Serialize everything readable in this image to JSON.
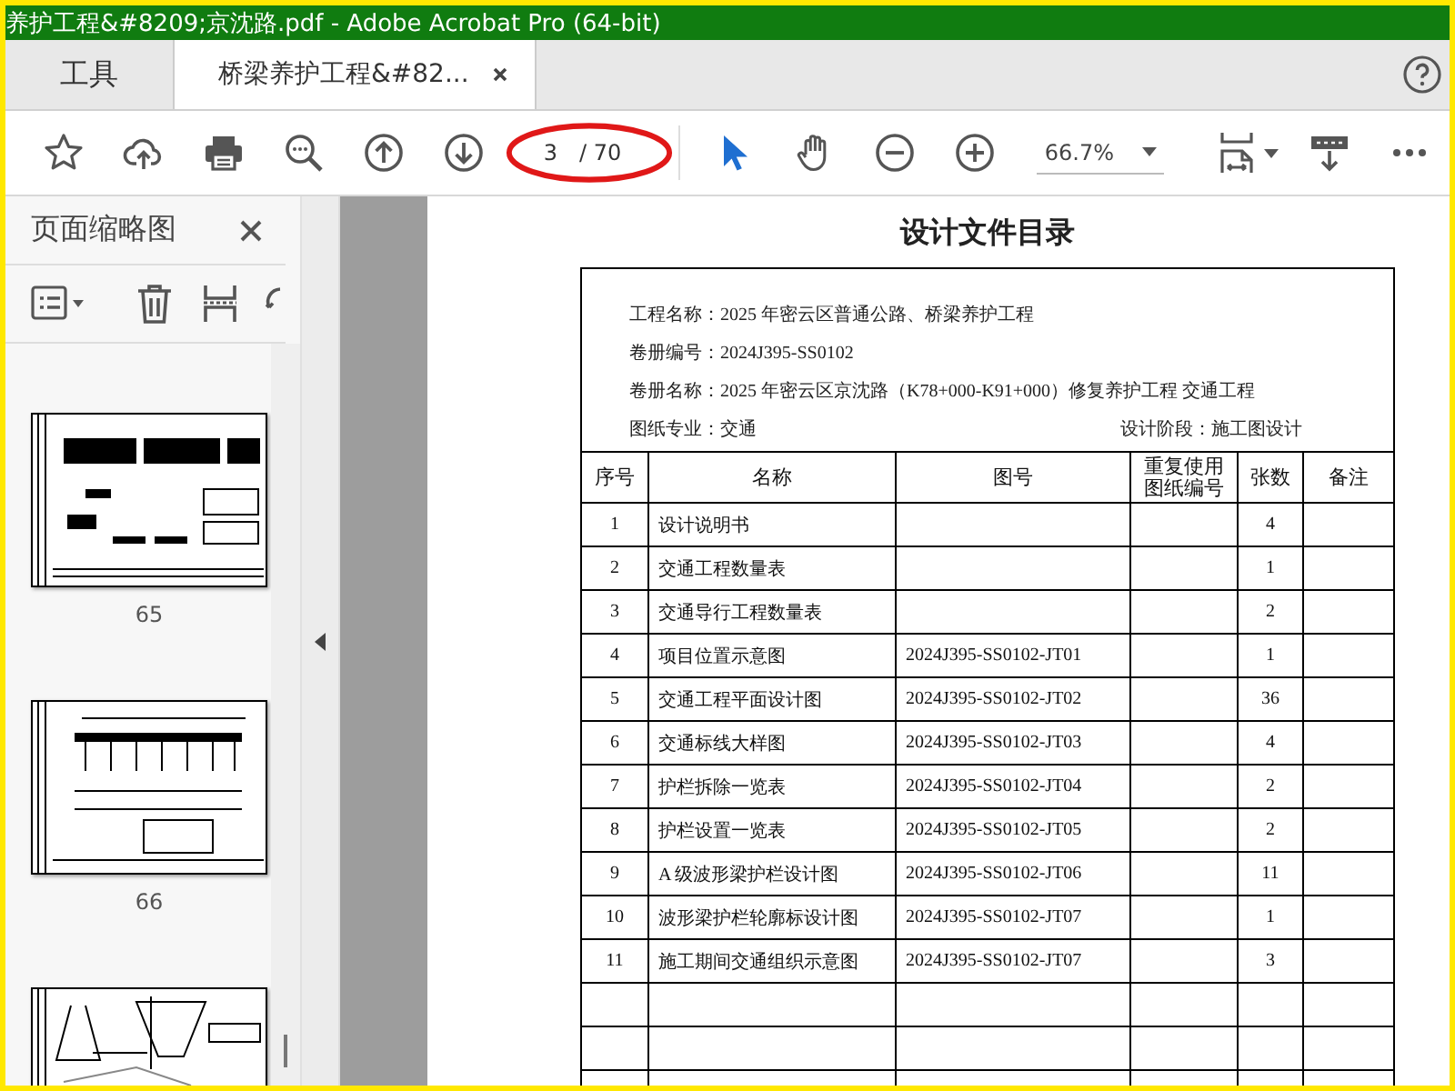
{
  "window": {
    "title": "养护工程&#8209;京沈路.pdf - Adobe Acrobat Pro (64-bit)"
  },
  "tabs": [
    {
      "label": "工具",
      "selected": false,
      "closable": false
    },
    {
      "label": "桥梁养护工程&#82...",
      "selected": true,
      "closable": true
    }
  ],
  "toolbar": {
    "page_current": "3",
    "page_total": "/ 70",
    "zoom": "66.7%",
    "pointer_tools": [
      {
        "kind": "select",
        "selected": true
      },
      {
        "kind": "hand",
        "selected": false
      }
    ]
  },
  "thumbnail_panel": {
    "title": "页面缩略图",
    "thumbnails": [
      {
        "kind": "plan",
        "label": "65"
      },
      {
        "kind": "elevation",
        "label": "66"
      },
      {
        "kind": "section"
      }
    ]
  },
  "document": {
    "title": "设计文件目录",
    "info": [
      [
        {
          "label": "工程名称：",
          "value": "2025 年密云区普通公路、桥梁养护工程"
        }
      ],
      [
        {
          "label": "卷册编号：",
          "value": "2024J395-SS0102"
        }
      ],
      [
        {
          "label": "卷册名称：",
          "value": "2025 年密云区京沈路（K78+000-K91+000）修复养护工程 交通工程"
        }
      ],
      [
        {
          "label": "图纸专业：",
          "value": "交通"
        },
        {
          "label": "设计阶段：",
          "value": "施工图设计"
        }
      ]
    ],
    "columns": [
      "序号",
      "名称",
      "图号",
      "重复使用图纸编号",
      "张数",
      "备注"
    ],
    "rows": [
      {
        "no": "1",
        "name": "设计说明书",
        "sheets": "4"
      },
      {
        "no": "2",
        "name": "交通工程数量表",
        "sheets": "1"
      },
      {
        "no": "3",
        "name": "交通导行工程数量表",
        "sheets": "2"
      },
      {
        "no": "4",
        "name": "项目位置示意图",
        "drawing_no": "2024J395-SS0102-JT01",
        "sheets": "1"
      },
      {
        "no": "5",
        "name": "交通工程平面设计图",
        "drawing_no": "2024J395-SS0102-JT02",
        "sheets": "36"
      },
      {
        "no": "6",
        "name": "交通标线大样图",
        "drawing_no": "2024J395-SS0102-JT03",
        "sheets": "4"
      },
      {
        "no": "7",
        "name": "护栏拆除一览表",
        "drawing_no": "2024J395-SS0102-JT04",
        "sheets": "2"
      },
      {
        "no": "8",
        "name": "护栏设置一览表",
        "drawing_no": "2024J395-SS0102-JT05",
        "sheets": "2"
      },
      {
        "no": "9",
        "name": "A 级波形梁护栏设计图",
        "drawing_no": "2024J395-SS0102-JT06",
        "sheets": "11"
      },
      {
        "no": "10",
        "name": "波形梁护栏轮廓标设计图",
        "drawing_no": "2024J395-SS0102-JT07",
        "sheets": "1"
      },
      {
        "no": "11",
        "name": "施工期间交通组织示意图",
        "drawing_no": "2024J395-SS0102-JT07",
        "sheets": "3"
      }
    ]
  }
}
